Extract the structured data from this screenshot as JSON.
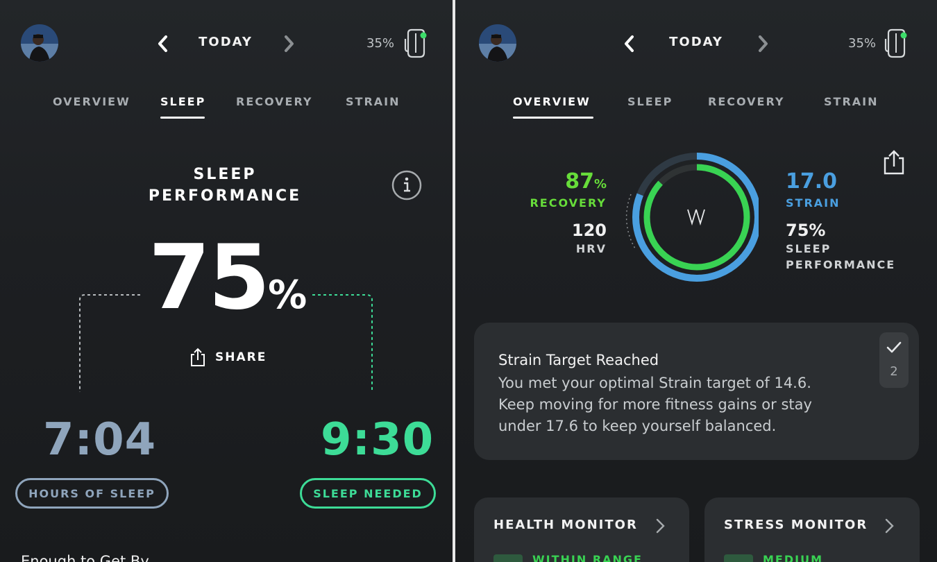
{
  "colors": {
    "green": "#39d353",
    "blue": "#4a9fe0",
    "recovery_green": "#67dd3a",
    "hours_blue": "#8fa5bc",
    "sleep_needed_green": "#3ddc97"
  },
  "device": {
    "battery": "35%"
  },
  "left": {
    "header": {
      "title": "TODAY"
    },
    "tabs": [
      {
        "label": "OVERVIEW"
      },
      {
        "label": "SLEEP"
      },
      {
        "label": "RECOVERY"
      },
      {
        "label": "STRAIN"
      }
    ],
    "active_tab": "SLEEP",
    "sleep_performance": {
      "title_line1": "SLEEP",
      "title_line2": "PERFORMANCE",
      "value": "75",
      "unit": "%",
      "share_label": "SHARE"
    },
    "hours_of_sleep": {
      "value": "7:04",
      "label": "HOURS OF SLEEP"
    },
    "sleep_needed": {
      "value": "9:30",
      "label": "SLEEP NEEDED"
    },
    "footer_text": "Enough to Get By"
  },
  "right": {
    "header": {
      "title": "TODAY"
    },
    "tabs": [
      {
        "label": "OVERVIEW"
      },
      {
        "label": "SLEEP"
      },
      {
        "label": "RECOVERY"
      },
      {
        "label": "STRAIN"
      }
    ],
    "active_tab": "OVERVIEW",
    "overview": {
      "recovery": {
        "value": "87",
        "unit": "%",
        "label": "RECOVERY",
        "fraction": 0.87
      },
      "hrv": {
        "value": "120",
        "label": "HRV"
      },
      "strain": {
        "value": "17.0",
        "label": "STRAIN",
        "fraction": 0.81
      },
      "sleep_performance": {
        "value": "75%",
        "label_line1": "SLEEP",
        "label_line2": "PERFORMANCE"
      },
      "logo": "W"
    },
    "notification": {
      "title": "Strain Target Reached",
      "body_line1": "You met your optimal Strain target of 14.6.",
      "body_line2": "Keep moving for more fitness gains or stay",
      "body_line3": "under 17.6 to keep yourself balanced.",
      "count": "2"
    },
    "monitors": [
      {
        "title": "HEALTH MONITOR",
        "status": "WITHIN RANGE"
      },
      {
        "title": "STRESS MONITOR",
        "status": "MEDIUM"
      }
    ]
  }
}
